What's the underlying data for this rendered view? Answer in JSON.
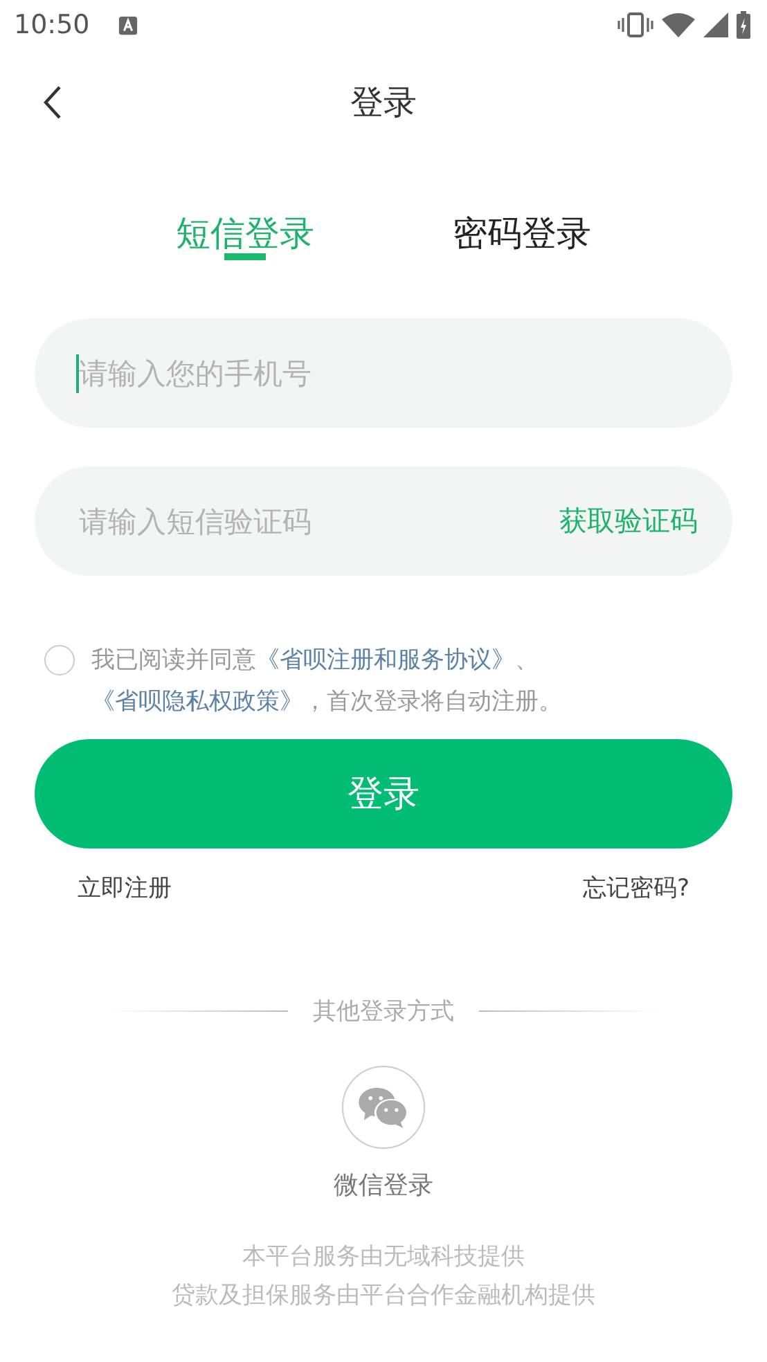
{
  "status_bar": {
    "time": "10:50"
  },
  "nav": {
    "title": "登录"
  },
  "tabs": [
    {
      "label": "短信登录",
      "selected": true
    },
    {
      "label": "密码登录",
      "selected": false
    }
  ],
  "phone_field": {
    "placeholder": "请输入您的手机号",
    "focused": true
  },
  "code_field": {
    "placeholder": "请输入短信验证码",
    "action": "获取验证码"
  },
  "agreement": {
    "checked": false,
    "parts": [
      {
        "kind": "text",
        "text": "我已阅读并同意"
      },
      {
        "kind": "link",
        "text": "《省呗注册和服务协议》"
      },
      {
        "kind": "text",
        "text": "、"
      },
      {
        "kind": "link",
        "text": "《省呗隐私权政策》"
      },
      {
        "kind": "text",
        "text": "，首次登录将自动注册。"
      }
    ]
  },
  "login_button": "登录",
  "register_link": "立即注册",
  "forgot_link": "忘记密码?",
  "other_login": {
    "title": "其他登录方式",
    "wechat_label": "微信登录"
  },
  "footer": [
    "本平台服务由无域科技提供",
    "贷款及担保服务由平台合作金融机构提供"
  ]
}
